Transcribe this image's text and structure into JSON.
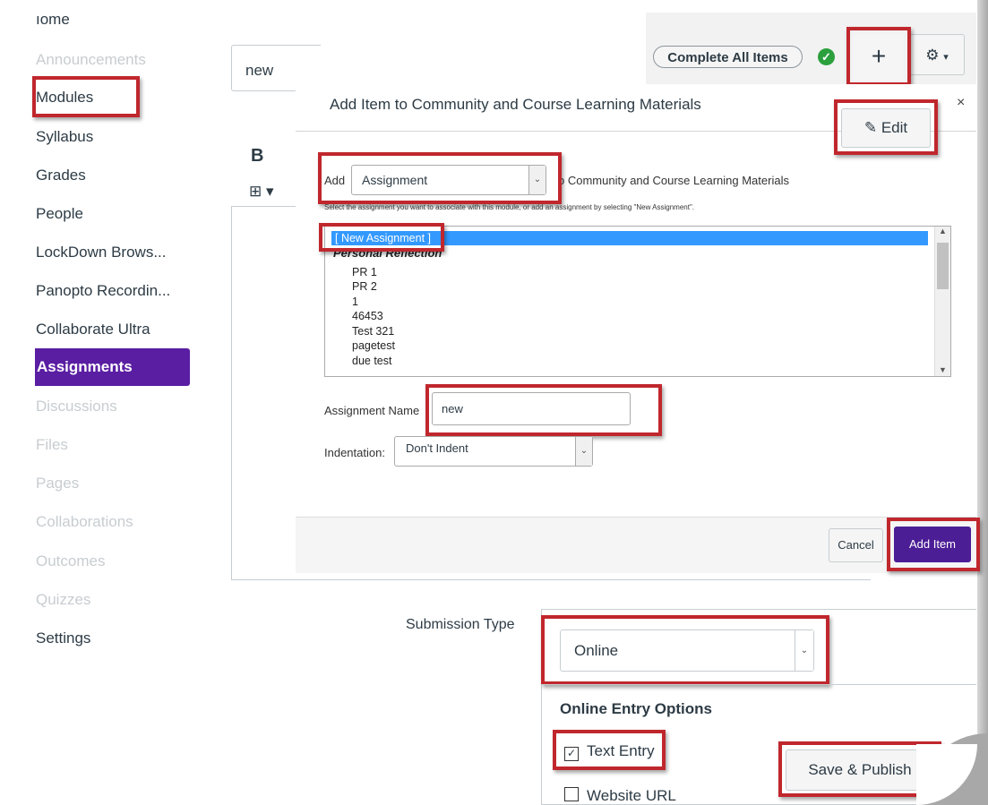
{
  "sidebar": {
    "items": [
      {
        "label": "ıome",
        "state": "normal"
      },
      {
        "label": "Announcements",
        "state": "muted"
      },
      {
        "label": "Modules",
        "state": "normal"
      },
      {
        "label": "Syllabus",
        "state": "normal"
      },
      {
        "label": "Grades",
        "state": "normal"
      },
      {
        "label": "People",
        "state": "normal"
      },
      {
        "label": "LockDown Brows...",
        "state": "normal"
      },
      {
        "label": "Panopto Recordin...",
        "state": "normal"
      },
      {
        "label": "Collaborate Ultra",
        "state": "normal"
      },
      {
        "label": "Assignments",
        "state": "active"
      },
      {
        "label": "Discussions",
        "state": "muted"
      },
      {
        "label": "Files",
        "state": "muted"
      },
      {
        "label": "Pages",
        "state": "muted"
      },
      {
        "label": "Collaborations",
        "state": "muted"
      },
      {
        "label": "Outcomes",
        "state": "muted"
      },
      {
        "label": "Quizzes",
        "state": "muted"
      },
      {
        "label": "Settings",
        "state": "normal"
      }
    ]
  },
  "toolbar": {
    "complete_all_label": "Complete All Items",
    "plus_label": "+",
    "gear_caret": "▾"
  },
  "editor": {
    "title_value": "new",
    "bold_label": "B",
    "table_icon": "⊞ ▾"
  },
  "dialog": {
    "title": "Add Item to Community and Course Learning Materials",
    "close_label": "×",
    "edit_label": "Edit",
    "add_label": "Add",
    "type_value": "Assignment",
    "to_text": "o Community and Course Learning Materials",
    "hint": "Select the assignment you want to associate with this module, or add an assignment by selecting \"New Assignment\".",
    "list": {
      "selected": "[ New Assignment ]",
      "group": "Personal Reflection",
      "items": [
        "PR 1",
        "PR 2",
        "1",
        "46453",
        "Test 321",
        "pagetest",
        "due test"
      ]
    },
    "name_label": "Assignment Name",
    "name_value": "new",
    "indent_label": "Indentation:",
    "indent_value": "Don't Indent",
    "cancel_label": "Cancel",
    "add_item_label": "Add Item"
  },
  "submission": {
    "label": "Submission Type",
    "type_value": "Online",
    "options_title": "Online Entry Options",
    "text_entry_label": "Text Entry",
    "text_entry_checked": true,
    "website_url_label": "Website URL",
    "website_url_checked": false,
    "save_label": "Save & Publish"
  },
  "colors": {
    "accent_purple": "#5a1ea3",
    "highlight_red": "#c0272d",
    "selection_blue": "#3399ff",
    "success_green": "#2ba03d"
  }
}
